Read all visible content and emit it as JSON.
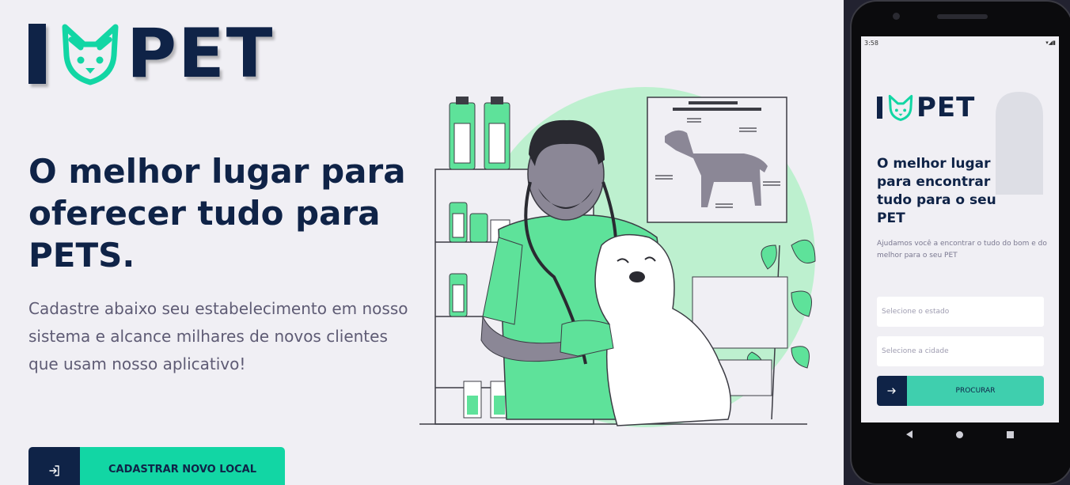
{
  "brand": {
    "logo_left": "I",
    "logo_right": "PET",
    "accent": "#12d6a4",
    "navy": "#0f2347"
  },
  "hero": {
    "headline": "O melhor lugar para oferecer tudo para PETS.",
    "subtext": "Cadastre abaixo seu estabelecimento em nosso sistema e alcance milhares de novos clientes que usam nosso aplicativo!",
    "cta_label": "CADASTRAR NOVO LOCAL",
    "cta_icon": "sign-in-icon"
  },
  "illustration": {
    "name": "veterinarian-with-dog-illustration"
  },
  "mobile": {
    "status_time": "3:58",
    "status_right": "▾◢▮",
    "logo_left": "I",
    "logo_right": "PET",
    "headline": "O melhor lugar para encontrar tudo para o seu PET",
    "subtext": "Ajudamos você a encontrar o tudo do bom e do melhor para o seu PET",
    "state_placeholder": "Selecione o estado",
    "city_placeholder": "Selecione a cidade",
    "search_label": "PROCURAR",
    "search_icon": "arrow-right-icon"
  }
}
